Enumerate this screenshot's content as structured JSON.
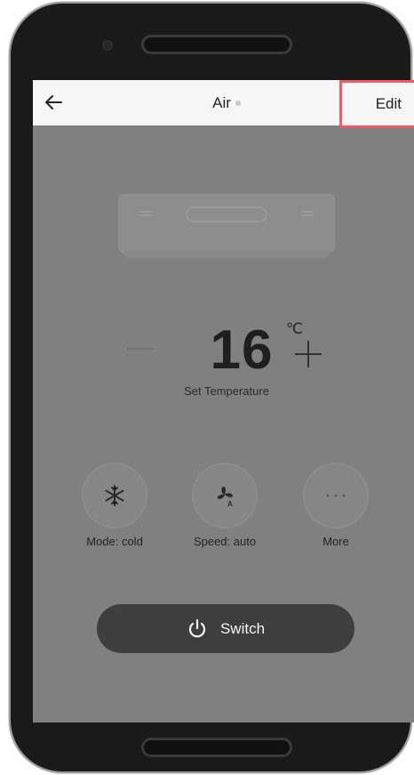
{
  "header": {
    "title": "Air",
    "edit_label": "Edit"
  },
  "temperature": {
    "value": "16",
    "unit": "℃",
    "label": "Set Temperature"
  },
  "controls": [
    {
      "label": "Mode: cold",
      "icon": "snowflake-icon"
    },
    {
      "label": "Speed: auto",
      "icon": "fan-auto-icon"
    },
    {
      "label": "More",
      "icon": "more-dots-icon"
    }
  ],
  "switch": {
    "label": "Switch",
    "icon": "power-icon"
  },
  "colors": {
    "overlay": "#808080",
    "edit_highlight": "#ee5a66",
    "switch_bg": "#3e3e3e"
  }
}
